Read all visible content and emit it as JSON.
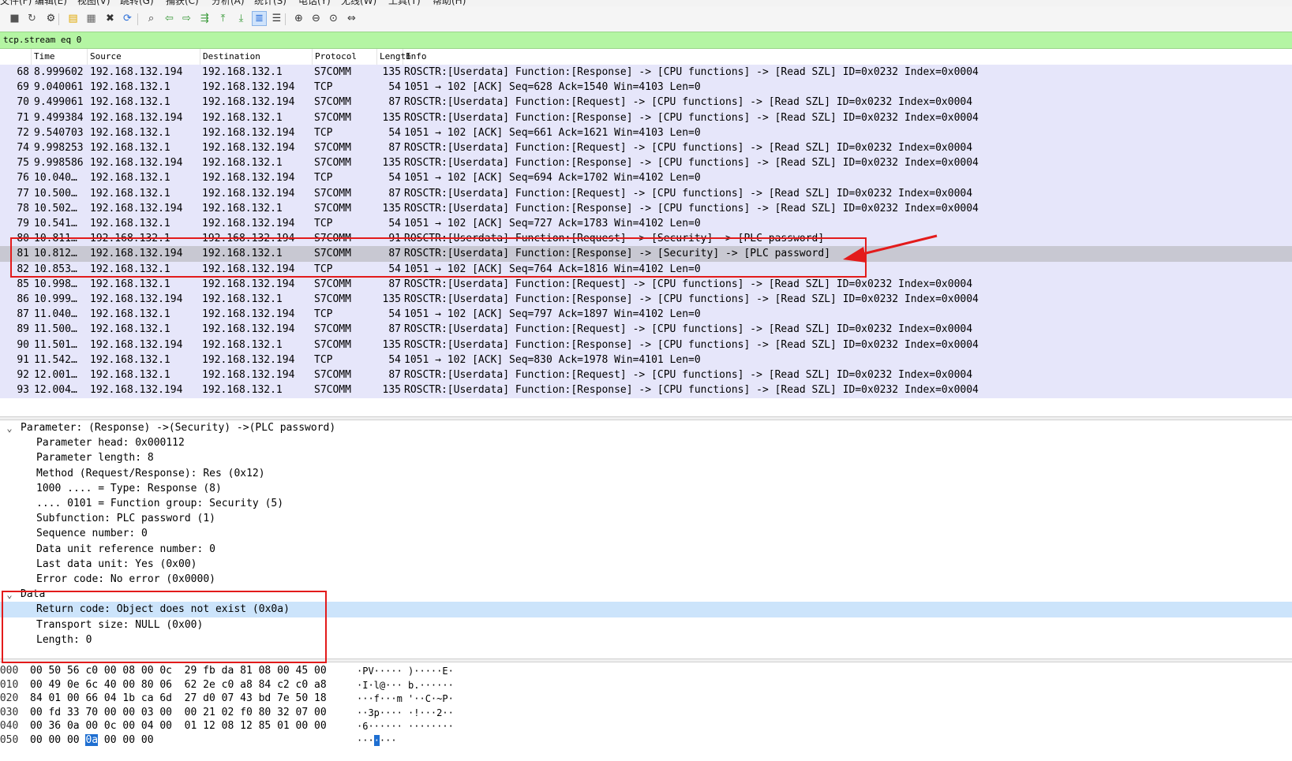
{
  "menu": [
    "文件(F)",
    "编辑(E)",
    "视图(V)",
    "跳转(G)",
    "捕获(C)",
    "分析(A)",
    "统计(S)",
    "电话(Y)",
    "无线(W)",
    "工具(T)",
    "帮助(H)"
  ],
  "toolbar": {
    "icons": [
      "stop-capture-icon",
      "restart-capture-icon",
      "capture-options-icon",
      "open-file-icon",
      "save-file-icon",
      "close-file-icon",
      "reload-file-icon",
      "find-packet-icon",
      "go-back-icon",
      "go-forward-icon",
      "go-to-packet-icon",
      "go-first-icon",
      "go-last-icon",
      "auto-scroll-icon",
      "colorize-icon",
      "zoom-in-icon",
      "zoom-out-icon",
      "zoom-normal-icon",
      "resize-columns-icon"
    ]
  },
  "filter": {
    "value": "tcp.stream eq 0"
  },
  "packet_list": {
    "columns": [
      "Time",
      "Source",
      "Destination",
      "Protocol",
      "Length",
      "Info"
    ],
    "rows": [
      {
        "no": "68",
        "time": "8.999602",
        "src": "192.168.132.194",
        "dst": "192.168.132.1",
        "proto": "S7COMM",
        "len": "135",
        "info": "ROSCTR:[Userdata] Function:[Response] -> [CPU functions] -> [Read SZL] ID=0x0232 Index=0x0004"
      },
      {
        "no": "69",
        "time": "9.040061",
        "src": "192.168.132.1",
        "dst": "192.168.132.194",
        "proto": "TCP",
        "len": "54",
        "info": "1051 → 102 [ACK] Seq=628 Ack=1540 Win=4103 Len=0"
      },
      {
        "no": "70",
        "time": "9.499061",
        "src": "192.168.132.1",
        "dst": "192.168.132.194",
        "proto": "S7COMM",
        "len": "87",
        "info": "ROSCTR:[Userdata] Function:[Request] -> [CPU functions] -> [Read SZL] ID=0x0232 Index=0x0004"
      },
      {
        "no": "71",
        "time": "9.499384",
        "src": "192.168.132.194",
        "dst": "192.168.132.1",
        "proto": "S7COMM",
        "len": "135",
        "info": "ROSCTR:[Userdata] Function:[Response] -> [CPU functions] -> [Read SZL] ID=0x0232 Index=0x0004"
      },
      {
        "no": "72",
        "time": "9.540703",
        "src": "192.168.132.1",
        "dst": "192.168.132.194",
        "proto": "TCP",
        "len": "54",
        "info": "1051 → 102 [ACK] Seq=661 Ack=1621 Win=4103 Len=0"
      },
      {
        "no": "74",
        "time": "9.998253",
        "src": "192.168.132.1",
        "dst": "192.168.132.194",
        "proto": "S7COMM",
        "len": "87",
        "info": "ROSCTR:[Userdata] Function:[Request] -> [CPU functions] -> [Read SZL] ID=0x0232 Index=0x0004"
      },
      {
        "no": "75",
        "time": "9.998586",
        "src": "192.168.132.194",
        "dst": "192.168.132.1",
        "proto": "S7COMM",
        "len": "135",
        "info": "ROSCTR:[Userdata] Function:[Response] -> [CPU functions] -> [Read SZL] ID=0x0232 Index=0x0004"
      },
      {
        "no": "76",
        "time": "10.040…",
        "src": "192.168.132.1",
        "dst": "192.168.132.194",
        "proto": "TCP",
        "len": "54",
        "info": "1051 → 102 [ACK] Seq=694 Ack=1702 Win=4102 Len=0"
      },
      {
        "no": "77",
        "time": "10.500…",
        "src": "192.168.132.1",
        "dst": "192.168.132.194",
        "proto": "S7COMM",
        "len": "87",
        "info": "ROSCTR:[Userdata] Function:[Request] -> [CPU functions] -> [Read SZL] ID=0x0232 Index=0x0004"
      },
      {
        "no": "78",
        "time": "10.502…",
        "src": "192.168.132.194",
        "dst": "192.168.132.1",
        "proto": "S7COMM",
        "len": "135",
        "info": "ROSCTR:[Userdata] Function:[Response] -> [CPU functions] -> [Read SZL] ID=0x0232 Index=0x0004"
      },
      {
        "no": "79",
        "time": "10.541…",
        "src": "192.168.132.1",
        "dst": "192.168.132.194",
        "proto": "TCP",
        "len": "54",
        "info": "1051 → 102 [ACK] Seq=727 Ack=1783 Win=4102 Len=0"
      },
      {
        "no": "80",
        "time": "10.811…",
        "src": "192.168.132.1",
        "dst": "192.168.132.194",
        "proto": "S7COMM",
        "len": "91",
        "info": "ROSCTR:[Userdata] Function:[Request] -> [Security] -> [PLC password]"
      },
      {
        "no": "81",
        "time": "10.812…",
        "src": "192.168.132.194",
        "dst": "192.168.132.1",
        "proto": "S7COMM",
        "len": "87",
        "info": "ROSCTR:[Userdata] Function:[Response] -> [Security] -> [PLC password]",
        "selected": true
      },
      {
        "no": "82",
        "time": "10.853…",
        "src": "192.168.132.1",
        "dst": "192.168.132.194",
        "proto": "TCP",
        "len": "54",
        "info": "1051 → 102 [ACK] Seq=764 Ack=1816 Win=4102 Len=0"
      },
      {
        "no": "85",
        "time": "10.998…",
        "src": "192.168.132.1",
        "dst": "192.168.132.194",
        "proto": "S7COMM",
        "len": "87",
        "info": "ROSCTR:[Userdata] Function:[Request] -> [CPU functions] -> [Read SZL] ID=0x0232 Index=0x0004"
      },
      {
        "no": "86",
        "time": "10.999…",
        "src": "192.168.132.194",
        "dst": "192.168.132.1",
        "proto": "S7COMM",
        "len": "135",
        "info": "ROSCTR:[Userdata] Function:[Response] -> [CPU functions] -> [Read SZL] ID=0x0232 Index=0x0004"
      },
      {
        "no": "87",
        "time": "11.040…",
        "src": "192.168.132.1",
        "dst": "192.168.132.194",
        "proto": "TCP",
        "len": "54",
        "info": "1051 → 102 [ACK] Seq=797 Ack=1897 Win=4102 Len=0"
      },
      {
        "no": "89",
        "time": "11.500…",
        "src": "192.168.132.1",
        "dst": "192.168.132.194",
        "proto": "S7COMM",
        "len": "87",
        "info": "ROSCTR:[Userdata] Function:[Request] -> [CPU functions] -> [Read SZL] ID=0x0232 Index=0x0004"
      },
      {
        "no": "90",
        "time": "11.501…",
        "src": "192.168.132.194",
        "dst": "192.168.132.1",
        "proto": "S7COMM",
        "len": "135",
        "info": "ROSCTR:[Userdata] Function:[Response] -> [CPU functions] -> [Read SZL] ID=0x0232 Index=0x0004"
      },
      {
        "no": "91",
        "time": "11.542…",
        "src": "192.168.132.1",
        "dst": "192.168.132.194",
        "proto": "TCP",
        "len": "54",
        "info": "1051 → 102 [ACK] Seq=830 Ack=1978 Win=4101 Len=0"
      },
      {
        "no": "92",
        "time": "12.001…",
        "src": "192.168.132.1",
        "dst": "192.168.132.194",
        "proto": "S7COMM",
        "len": "87",
        "info": "ROSCTR:[Userdata] Function:[Request] -> [CPU functions] -> [Read SZL] ID=0x0232 Index=0x0004"
      },
      {
        "no": "93",
        "time": "12.004…",
        "src": "192.168.132.194",
        "dst": "192.168.132.1",
        "proto": "S7COMM",
        "len": "135",
        "info": "ROSCTR:[Userdata] Function:[Response] -> [CPU functions] -> [Read SZL] ID=0x0232 Index=0x0004"
      }
    ]
  },
  "details": [
    {
      "text": "Parameter: (Response) ->(Security) ->(PLC password)",
      "level": 0,
      "expanded": true
    },
    {
      "text": "Parameter head: 0x000112",
      "level": 1
    },
    {
      "text": "Parameter length: 8",
      "level": 1
    },
    {
      "text": "Method (Request/Response): Res (0x12)",
      "level": 1
    },
    {
      "text": "1000 .... = Type: Response (8)",
      "level": 1
    },
    {
      "text": ".... 0101 = Function group: Security (5)",
      "level": 1
    },
    {
      "text": "Subfunction: PLC password (1)",
      "level": 1
    },
    {
      "text": "Sequence number: 0",
      "level": 1
    },
    {
      "text": "Data unit reference number: 0",
      "level": 1
    },
    {
      "text": "Last data unit: Yes (0x00)",
      "level": 1
    },
    {
      "text": "Error code: No error (0x0000)",
      "level": 1
    },
    {
      "text": "Data",
      "level": 0,
      "expanded": true
    },
    {
      "text": "Return code: Object does not exist (0x0a)",
      "level": 1,
      "selected": true
    },
    {
      "text": "Transport size: NULL (0x00)",
      "level": 1
    },
    {
      "text": "Length: 0",
      "level": 1
    }
  ],
  "bytes": [
    {
      "offset": "0000",
      "hex1": "00 50 56 c0 00 08 00 0c",
      "hex2": "29 fb da 81 08 00 45 00",
      "ascii": "·PV····· )·····E·"
    },
    {
      "offset": "0010",
      "hex1": "00 49 0e 6c 40 00 80 06",
      "hex2": "62 2e c0 a8 84 c2 c0 a8",
      "ascii": "·I·l@··· b.······"
    },
    {
      "offset": "0020",
      "hex1": "84 01 00 66 04 1b ca 6d",
      "hex2": "27 d0 07 43 bd 7e 50 18",
      "ascii": "···f···m '··C·~P·"
    },
    {
      "offset": "0030",
      "hex1": "00 fd 33 70 00 00 03 00",
      "hex2": "00 21 02 f0 80 32 07 00",
      "ascii": "··3p···· ·!···2··"
    },
    {
      "offset": "0040",
      "hex1": "00 36 0a 00 0c 00 04 00",
      "hex2": "01 12 08 12 85 01 00 00",
      "ascii": "·6······ ········"
    },
    {
      "offset": "0050",
      "hex1a": "00 00 00 ",
      "hex1sel": "0a",
      "hex1b": " 00 00 00",
      "asciia": "···",
      "asciisel": "·",
      "asciib": "···"
    }
  ],
  "colors": {
    "filter_bg": "#b4f5a3",
    "row_bg": "#e6e6fa",
    "selected_row": "#c8c8d2",
    "selected_tree": "#cce4fb",
    "annotation": "#e31b1b",
    "byte_highlight": "#1f6fd1"
  }
}
